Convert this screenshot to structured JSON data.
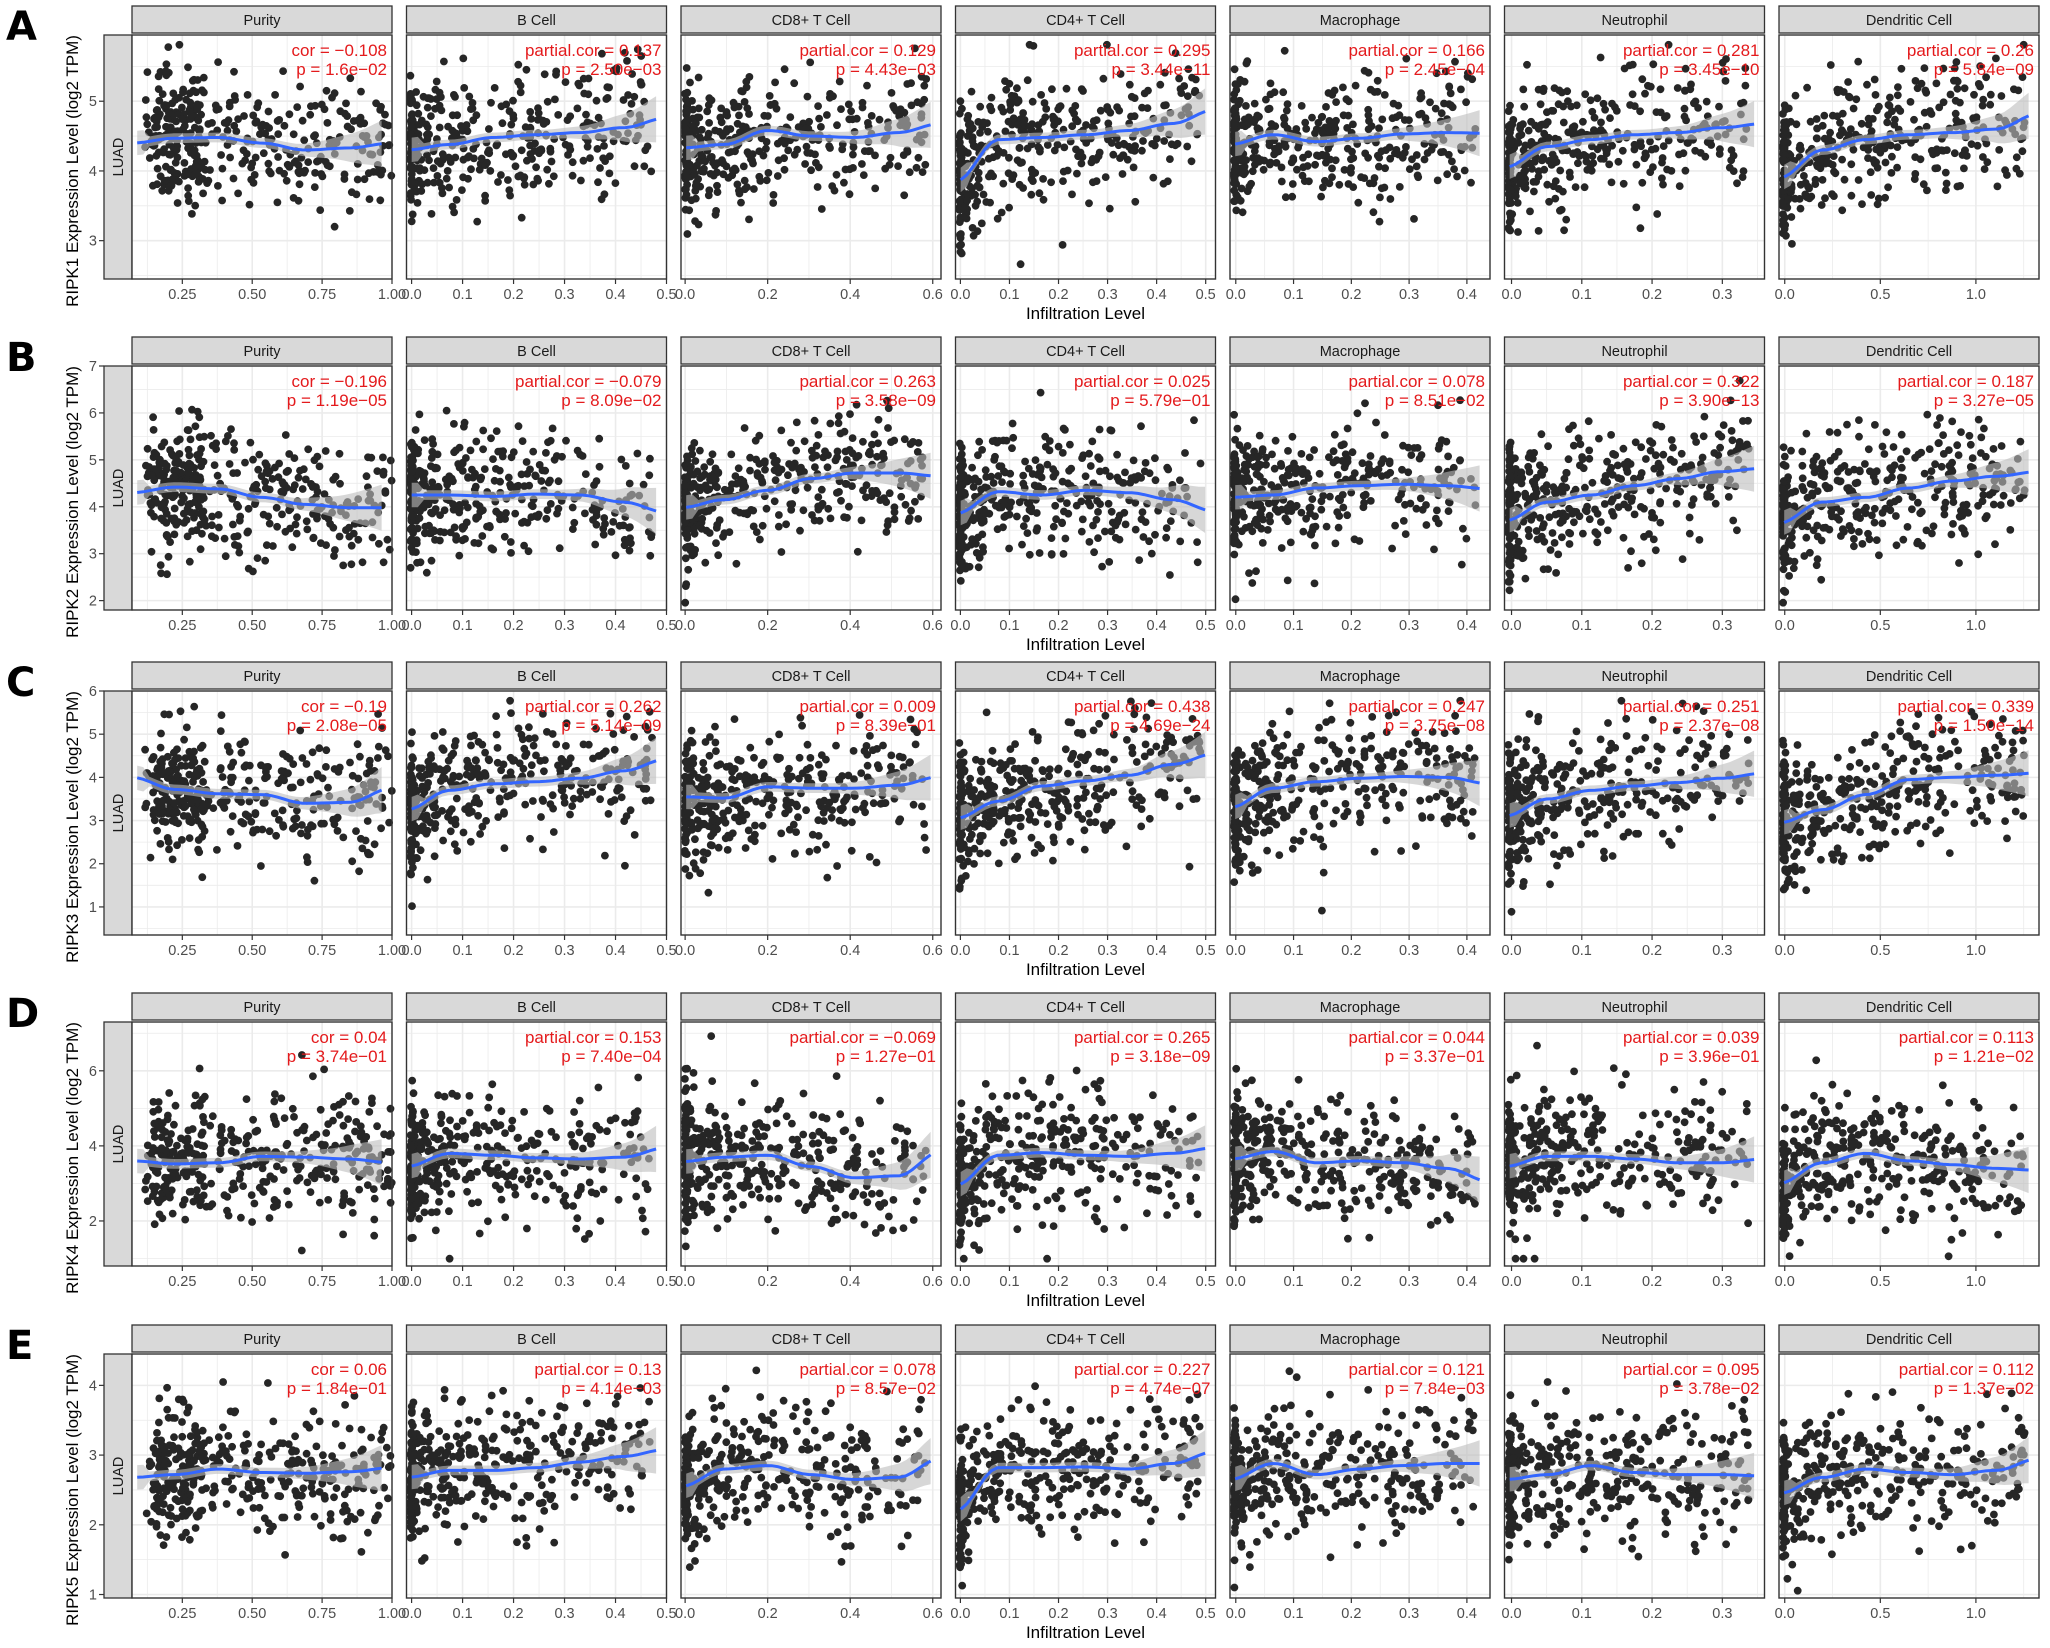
{
  "figure": {
    "cancer_label": "LUAD",
    "x_axis_title": "Infiltration Level",
    "colors": {
      "points": "#262626",
      "smooth_line": "#3366ff",
      "confidence_band": "#bdbdbd",
      "stat_text": "#e41a1c",
      "strip_fill": "#d9d9d9",
      "grid": "#ebebeb"
    }
  },
  "chart_data": {
    "type": "scatter",
    "title": "",
    "description": "Faceted scatter plots (TIMER) of RIPK1-5 expression vs tumor purity and immune cell infiltration in LUAD, with loess smooth line and confidence band",
    "xlabel": "Infiltration Level",
    "grid": true,
    "columns": [
      {
        "name": "Purity",
        "xlim": [
          0.07,
          1.0
        ],
        "xticks": [
          0.25,
          0.5,
          0.75,
          1.0
        ],
        "xtick_labels": [
          "0.25",
          "0.50",
          "0.75",
          "1.00"
        ]
      },
      {
        "name": "B Cell",
        "xlim": [
          -0.01,
          0.5
        ],
        "xticks": [
          0.0,
          0.1,
          0.2,
          0.3,
          0.4,
          0.5
        ],
        "xtick_labels": [
          "0.0",
          "0.1",
          "0.2",
          "0.3",
          "0.4",
          "0.5"
        ]
      },
      {
        "name": "CD8+ T Cell",
        "xlim": [
          -0.01,
          0.62
        ],
        "xticks": [
          0.0,
          0.2,
          0.4,
          0.6
        ],
        "xtick_labels": [
          "0.0",
          "0.2",
          "0.4",
          "0.6"
        ]
      },
      {
        "name": "CD4+ T Cell",
        "xlim": [
          -0.01,
          0.52
        ],
        "xticks": [
          0.0,
          0.1,
          0.2,
          0.3,
          0.4,
          0.5
        ],
        "xtick_labels": [
          "0.0",
          "0.1",
          "0.2",
          "0.3",
          "0.4",
          "0.5"
        ]
      },
      {
        "name": "Macrophage",
        "xlim": [
          -0.01,
          0.44
        ],
        "xticks": [
          0.0,
          0.1,
          0.2,
          0.3,
          0.4
        ],
        "xtick_labels": [
          "0.0",
          "0.1",
          "0.2",
          "0.3",
          "0.4"
        ]
      },
      {
        "name": "Neutrophil",
        "xlim": [
          -0.01,
          0.36
        ],
        "xticks": [
          0.0,
          0.1,
          0.2,
          0.3
        ],
        "xtick_labels": [
          "0.0",
          "0.1",
          "0.2",
          "0.3"
        ]
      },
      {
        "name": "Dendritic Cell",
        "xlim": [
          -0.03,
          1.33
        ],
        "xticks": [
          0.0,
          0.5,
          1.0
        ],
        "xtick_labels": [
          "0.0",
          "0.5",
          "1.0"
        ]
      }
    ],
    "rows": [
      {
        "letter": "A",
        "ylabel": "RIPK1 Expression Level (log2 TPM)",
        "ylim": [
          2.45,
          5.95
        ],
        "yticks": [
          3,
          4,
          5
        ],
        "ytick_labels": [
          "3",
          "4",
          "5"
        ],
        "panels": [
          {
            "cell": "Purity",
            "stat_label": "cor = -0.108",
            "p_label": "p = 1.6e-02",
            "cor": -0.108,
            "p": 0.016,
            "trend": [
              4.4,
              4.47,
              4.48,
              4.4,
              4.3,
              4.33,
              4.4
            ]
          },
          {
            "cell": "B Cell",
            "stat_label": "partial.cor = 0.137",
            "p_label": "p = 2.50e-03",
            "cor": 0.137,
            "p": 0.0025,
            "trend": [
              4.3,
              4.38,
              4.48,
              4.52,
              4.55,
              4.62,
              4.76
            ]
          },
          {
            "cell": "CD8+ T Cell",
            "stat_label": "partial.cor = 0.129",
            "p_label": "p = 4.43e-03",
            "cor": 0.129,
            "p": 0.00443,
            "trend": [
              4.33,
              4.38,
              4.58,
              4.5,
              4.48,
              4.55,
              4.68
            ]
          },
          {
            "cell": "CD4+ T Cell",
            "stat_label": "partial.cor = 0.295",
            "p_label": "p = 3.44e-11",
            "cor": 0.295,
            "p": 3.44e-11,
            "trend": [
              3.85,
              4.45,
              4.48,
              4.52,
              4.58,
              4.68,
              4.88
            ]
          },
          {
            "cell": "Macrophage",
            "stat_label": "partial.cor = 0.166",
            "p_label": "p = 2.45e-04",
            "cor": 0.166,
            "p": 0.000245,
            "trend": [
              4.38,
              4.52,
              4.42,
              4.47,
              4.53,
              4.55,
              4.54
            ]
          },
          {
            "cell": "Neutrophil",
            "stat_label": "partial.cor = 0.281",
            "p_label": "p = 3.45e-10",
            "cor": 0.281,
            "p": 3.45e-10,
            "trend": [
              4.05,
              4.35,
              4.45,
              4.52,
              4.55,
              4.62,
              4.68
            ]
          },
          {
            "cell": "Dendritic Cell",
            "stat_label": "partial.cor = 0.26",
            "p_label": "p = 5.84e-09",
            "cor": 0.26,
            "p": 5.84e-09,
            "trend": [
              3.9,
              4.3,
              4.45,
              4.52,
              4.55,
              4.6,
              4.82
            ]
          }
        ]
      },
      {
        "letter": "B",
        "ylabel": "RIPK2 Expression Level (log2 TPM)",
        "ylim": [
          1.8,
          7.0
        ],
        "yticks": [
          2,
          3,
          4,
          5,
          6,
          7
        ],
        "ytick_labels": [
          "2",
          "3",
          "4",
          "5",
          "6",
          "7"
        ],
        "panels": [
          {
            "cell": "Purity",
            "stat_label": "cor = -0.196",
            "p_label": "p = 1.19e-05",
            "cor": -0.196,
            "p": 1.19e-05,
            "trend": [
              4.3,
              4.42,
              4.38,
              4.2,
              4.05,
              3.98,
              3.98
            ]
          },
          {
            "cell": "B Cell",
            "stat_label": "partial.cor = -0.079",
            "p_label": "p = 8.09e-02",
            "cor": -0.079,
            "p": 0.0809,
            "trend": [
              4.25,
              4.25,
              4.22,
              4.27,
              4.25,
              4.1,
              3.88
            ]
          },
          {
            "cell": "CD8+ T Cell",
            "stat_label": "partial.cor = 0.263",
            "p_label": "p = 3.58e-09",
            "cor": 0.263,
            "p": 3.58e-09,
            "trend": [
              3.98,
              4.15,
              4.35,
              4.6,
              4.72,
              4.72,
              4.65
            ]
          },
          {
            "cell": "CD4+ T Cell",
            "stat_label": "partial.cor = 0.025",
            "p_label": "p = 5.79e-01",
            "cor": 0.025,
            "p": 0.579,
            "trend": [
              3.85,
              4.32,
              4.25,
              4.35,
              4.3,
              4.15,
              3.9
            ]
          },
          {
            "cell": "Macrophage",
            "stat_label": "partial.cor = 0.078",
            "p_label": "p = 8.51e-02",
            "cor": 0.078,
            "p": 0.0851,
            "trend": [
              4.2,
              4.25,
              4.4,
              4.45,
              4.48,
              4.45,
              4.38
            ]
          },
          {
            "cell": "Neutrophil",
            "stat_label": "partial.cor = 0.322",
            "p_label": "p = 3.90e-13",
            "cor": 0.322,
            "p": 3.9e-13,
            "trend": [
              3.7,
              4.1,
              4.25,
              4.45,
              4.6,
              4.75,
              4.82
            ]
          },
          {
            "cell": "Dendritic Cell",
            "stat_label": "partial.cor = 0.187",
            "p_label": "p = 3.27e-05",
            "cor": 0.187,
            "p": 3.27e-05,
            "trend": [
              3.65,
              4.1,
              4.2,
              4.4,
              4.55,
              4.65,
              4.75
            ]
          }
        ]
      },
      {
        "letter": "C",
        "ylabel": "RIPK3 Expression Level (log2 TPM)",
        "ylim": [
          0.35,
          6.0
        ],
        "yticks": [
          1,
          2,
          3,
          4,
          5,
          6
        ],
        "ytick_labels": [
          "1",
          "2",
          "3",
          "4",
          "5",
          "6"
        ],
        "panels": [
          {
            "cell": "Purity",
            "stat_label": "cor = -0.19",
            "p_label": "p = 2.08e-05",
            "cor": -0.19,
            "p": 2.08e-05,
            "trend": [
              4.0,
              3.72,
              3.62,
              3.6,
              3.4,
              3.42,
              3.75
            ]
          },
          {
            "cell": "B Cell",
            "stat_label": "partial.cor = 0.262",
            "p_label": "p = 5.14e-09",
            "cor": 0.262,
            "p": 5.14e-09,
            "trend": [
              3.25,
              3.7,
              3.85,
              3.9,
              3.98,
              4.15,
              4.42
            ]
          },
          {
            "cell": "CD8+ T Cell",
            "stat_label": "partial.cor = 0.009",
            "p_label": "p = 8.39e-01",
            "cor": 0.009,
            "p": 0.839,
            "trend": [
              3.55,
              3.52,
              3.78,
              3.75,
              3.75,
              3.82,
              4.02
            ]
          },
          {
            "cell": "CD4+ T Cell",
            "stat_label": "partial.cor = 0.438",
            "p_label": "p = 4.69e-24",
            "cor": 0.438,
            "p": 4.69e-24,
            "trend": [
              3.05,
              3.45,
              3.8,
              3.92,
              4.05,
              4.3,
              4.55
            ]
          },
          {
            "cell": "Macrophage",
            "stat_label": "partial.cor = 0.247",
            "p_label": "p = 3.75e-08",
            "cor": 0.247,
            "p": 3.75e-08,
            "trend": [
              3.3,
              3.75,
              3.9,
              3.98,
              4.02,
              4.0,
              3.85
            ]
          },
          {
            "cell": "Neutrophil",
            "stat_label": "partial.cor = 0.251",
            "p_label": "p = 2.37e-08",
            "cor": 0.251,
            "p": 2.37e-08,
            "trend": [
              3.1,
              3.5,
              3.7,
              3.8,
              3.88,
              3.98,
              4.1
            ]
          },
          {
            "cell": "Dendritic Cell",
            "stat_label": "partial.cor = 0.339",
            "p_label": "p = 1.50e-14",
            "cor": 0.339,
            "p": 1.5e-14,
            "trend": [
              2.95,
              3.25,
              3.6,
              3.95,
              4.0,
              4.05,
              4.1
            ]
          }
        ]
      },
      {
        "letter": "D",
        "ylabel": "RIPK4 Expression Level (log2 TPM)",
        "ylim": [
          0.8,
          7.3
        ],
        "yticks": [
          2,
          4,
          6
        ],
        "ytick_labels": [
          "2",
          "4",
          "6"
        ],
        "panels": [
          {
            "cell": "Purity",
            "stat_label": "cor = 0.04",
            "p_label": "p = 3.74e-01",
            "cor": 0.04,
            "p": 0.374,
            "trend": [
              3.6,
              3.52,
              3.55,
              3.72,
              3.7,
              3.65,
              3.55
            ]
          },
          {
            "cell": "B Cell",
            "stat_label": "partial.cor = 0.153",
            "p_label": "p = 7.40e-04",
            "cor": 0.153,
            "p": 0.00074,
            "trend": [
              3.45,
              3.8,
              3.75,
              3.68,
              3.65,
              3.7,
              3.95
            ]
          },
          {
            "cell": "CD8+ T Cell",
            "stat_label": "partial.cor = -0.069",
            "p_label": "p = 1.27e-01",
            "cor": -0.069,
            "p": 0.127,
            "trend": [
              3.58,
              3.7,
              3.75,
              3.45,
              3.15,
              3.2,
              3.85
            ]
          },
          {
            "cell": "CD4+ T Cell",
            "stat_label": "partial.cor = 0.265",
            "p_label": "p = 3.18e-09",
            "cor": 0.265,
            "p": 3.18e-09,
            "trend": [
              2.95,
              3.75,
              3.82,
              3.75,
              3.72,
              3.8,
              3.95
            ]
          },
          {
            "cell": "Macrophage",
            "stat_label": "partial.cor = 0.044",
            "p_label": "p = 3.37e-01",
            "cor": 0.044,
            "p": 0.337,
            "trend": [
              3.65,
              3.85,
              3.55,
              3.6,
              3.55,
              3.4,
              3.05
            ]
          },
          {
            "cell": "Neutrophil",
            "stat_label": "partial.cor = 0.039",
            "p_label": "p = 3.96e-01",
            "cor": 0.039,
            "p": 0.396,
            "trend": [
              3.45,
              3.72,
              3.72,
              3.65,
              3.55,
              3.55,
              3.65
            ]
          },
          {
            "cell": "Dendritic Cell",
            "stat_label": "partial.cor = 0.113",
            "p_label": "p = 1.21e-02",
            "cor": 0.113,
            "p": 0.0121,
            "trend": [
              3.0,
              3.55,
              3.8,
              3.6,
              3.5,
              3.4,
              3.35
            ]
          }
        ]
      },
      {
        "letter": "E",
        "ylabel": "RIPK5 Expression Level (log2 TPM)",
        "ylim": [
          0.95,
          4.45
        ],
        "yticks": [
          1,
          2,
          3,
          4
        ],
        "ytick_labels": [
          "1",
          "2",
          "3",
          "4"
        ],
        "panels": [
          {
            "cell": "Purity",
            "stat_label": "cor = 0.06",
            "p_label": "p = 1.84e-01",
            "cor": 0.06,
            "p": 0.184,
            "trend": [
              2.68,
              2.72,
              2.8,
              2.75,
              2.74,
              2.76,
              2.82
            ]
          },
          {
            "cell": "B Cell",
            "stat_label": "partial.cor = 0.13",
            "p_label": "p = 4.14e-03",
            "cor": 0.13,
            "p": 0.00414,
            "trend": [
              2.68,
              2.78,
              2.78,
              2.82,
              2.9,
              2.98,
              3.08
            ]
          },
          {
            "cell": "CD8+ T Cell",
            "stat_label": "partial.cor = 0.078",
            "p_label": "p = 8.57e-02",
            "cor": 0.078,
            "p": 0.0857,
            "trend": [
              2.55,
              2.8,
              2.85,
              2.72,
              2.65,
              2.68,
              2.95
            ]
          },
          {
            "cell": "CD4+ T Cell",
            "stat_label": "partial.cor = 0.227",
            "p_label": "p = 4.74e-07",
            "cor": 0.227,
            "p": 4.74e-07,
            "trend": [
              2.2,
              2.82,
              2.82,
              2.83,
              2.8,
              2.88,
              3.05
            ]
          },
          {
            "cell": "Macrophage",
            "stat_label": "partial.cor = 0.121",
            "p_label": "p = 7.84e-03",
            "cor": 0.121,
            "p": 0.00784,
            "trend": [
              2.65,
              2.88,
              2.72,
              2.8,
              2.85,
              2.88,
              2.88
            ]
          },
          {
            "cell": "Neutrophil",
            "stat_label": "partial.cor = 0.095",
            "p_label": "p = 3.78e-02",
            "cor": 0.095,
            "p": 0.0378,
            "trend": [
              2.65,
              2.72,
              2.85,
              2.75,
              2.72,
              2.72,
              2.7
            ]
          },
          {
            "cell": "Dendritic Cell",
            "stat_label": "partial.cor = 0.112",
            "p_label": "p = 1.37e-02",
            "cor": 0.112,
            "p": 0.0137,
            "trend": [
              2.45,
              2.68,
              2.8,
              2.75,
              2.72,
              2.78,
              2.95
            ]
          }
        ]
      }
    ]
  }
}
